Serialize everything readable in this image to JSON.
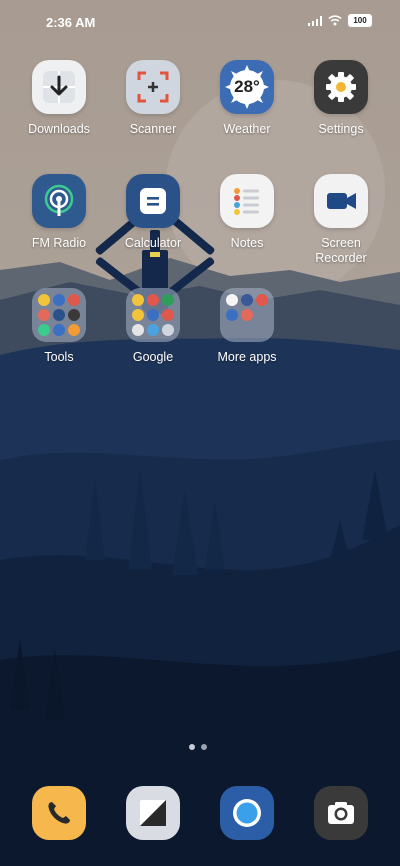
{
  "status_bar": {
    "time": "2:36 AM",
    "battery": "100"
  },
  "weather": {
    "temp": "28°"
  },
  "apps_row1": [
    {
      "label": "Downloads",
      "icon": "download-icon"
    },
    {
      "label": "Scanner",
      "icon": "scanner-icon"
    },
    {
      "label": "Weather",
      "icon": "weather-sun-icon"
    },
    {
      "label": "Settings",
      "icon": "gear-icon"
    }
  ],
  "apps_row2": [
    {
      "label": "FM Radio",
      "icon": "radio-icon"
    },
    {
      "label": "Calculator",
      "icon": "calculator-icon"
    },
    {
      "label": "Notes",
      "icon": "notes-icon"
    },
    {
      "label": "Screen Recorder",
      "icon": "video-camera-icon"
    }
  ],
  "folders": [
    {
      "label": "Tools"
    },
    {
      "label": "Google"
    },
    {
      "label": "More apps"
    }
  ],
  "dock": [
    {
      "icon": "phone-icon"
    },
    {
      "icon": "notes-square-icon"
    },
    {
      "icon": "messages-bubble-icon"
    },
    {
      "icon": "camera-icon"
    }
  ],
  "colors": {
    "sky": "#a79c93",
    "mountain_near": "#1b3254",
    "dock_phone": "#f6b84c"
  }
}
